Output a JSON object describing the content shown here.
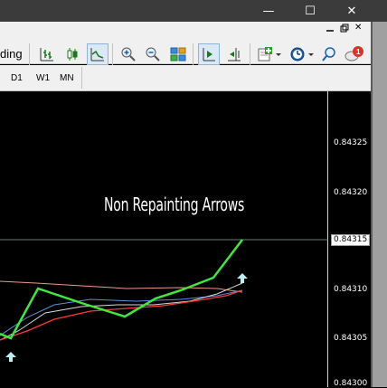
{
  "window": {
    "minimize_glyph": "—",
    "maximize_glyph": "☐",
    "close_glyph": "✕"
  },
  "toolbar": {
    "partial_label": "ding",
    "buttons": [
      "bar-chart-icon",
      "candlestick-icon",
      "line-chart-icon",
      "zoom-in-icon",
      "zoom-out-icon",
      "tile-windows-icon",
      "chart-shift-icon",
      "autoscroll-icon",
      "indicators-icon",
      "periods-icon",
      "search-icon",
      "notification-icon"
    ],
    "notification_count": "1",
    "mdi_restore_glyph": "🗗",
    "mdi_close_glyph": "✕"
  },
  "timeframes": [
    "D1",
    "W1",
    "MN"
  ],
  "chart": {
    "overlay_text": "Non Repainting Arrows",
    "current_price": "0.84315",
    "price_labels": [
      "0.84325",
      "0.84320",
      "0.84310",
      "0.84305",
      "0.84300"
    ],
    "colors": {
      "background": "#000000",
      "green_line": "#3ee83e",
      "red_ma": "#ff3a3a",
      "salmon_ma": "#e89a8a",
      "white_ma": "#d8d8d8",
      "blue_ma": "#5a8fd8",
      "arrow": "#b8f0f0"
    }
  }
}
